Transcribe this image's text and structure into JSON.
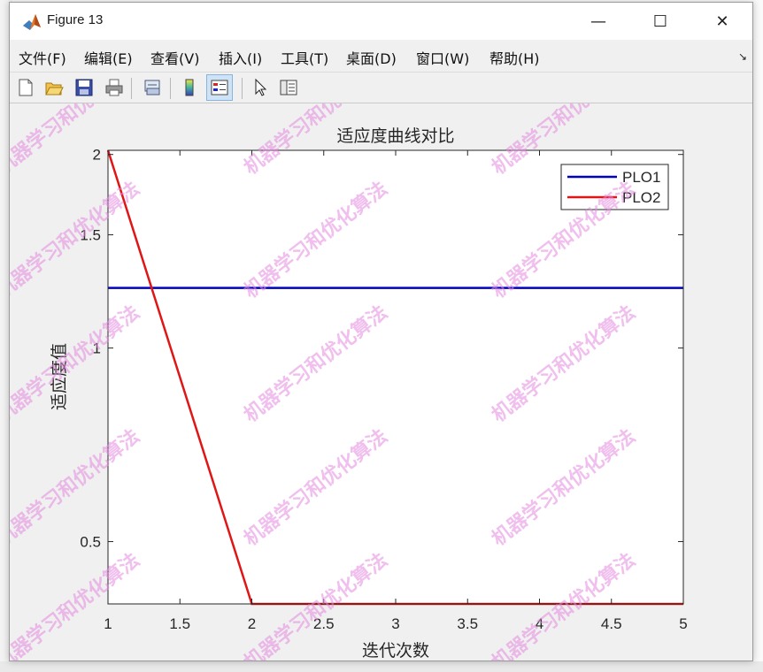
{
  "window": {
    "title": "Figure 13",
    "controls": {
      "minimize": "—",
      "maximize": "☐",
      "close": "✕"
    }
  },
  "menubar": {
    "items": [
      "文件(F)",
      "编辑(E)",
      "查看(V)",
      "插入(I)",
      "工具(T)",
      "桌面(D)",
      "窗口(W)",
      "帮助(H)"
    ],
    "overflow_arrow": "↘"
  },
  "toolbar": {
    "tools": [
      {
        "name": "new-figure-icon"
      },
      {
        "name": "open-file-icon"
      },
      {
        "name": "save-icon"
      },
      {
        "name": "print-icon"
      },
      {
        "name": "link-plot-icon"
      },
      {
        "name": "insert-colorbar-icon"
      },
      {
        "name": "insert-legend-icon",
        "pressed": true
      },
      {
        "name": "edit-plot-icon"
      },
      {
        "name": "property-inspector-icon"
      }
    ]
  },
  "watermark": "机器学习和优化算法",
  "chart_data": {
    "type": "line",
    "title": "适应度曲线对比",
    "xlabel": "迭代次数",
    "ylabel": "适应度值",
    "xlim": [
      1,
      5
    ],
    "ylim": [
      0.4,
      2.03
    ],
    "yscale": "log",
    "xticks": [
      "1",
      "1.5",
      "2",
      "2.5",
      "3",
      "3.5",
      "4",
      "4.5",
      "5"
    ],
    "yticks": [
      "0.5",
      "1",
      "1.5",
      "2"
    ],
    "legend_position": "top-right",
    "series": [
      {
        "name": "PLO1",
        "color": "#0000c0",
        "x": [
          1,
          2,
          3,
          4,
          5
        ],
        "y": [
          1.24,
          1.24,
          1.24,
          1.24,
          1.24
        ]
      },
      {
        "name": "PLO2",
        "color": "#e01515",
        "x": [
          1,
          2,
          3,
          4,
          5
        ],
        "y": [
          2.03,
          0.4,
          0.4,
          0.4,
          0.4
        ]
      }
    ]
  }
}
